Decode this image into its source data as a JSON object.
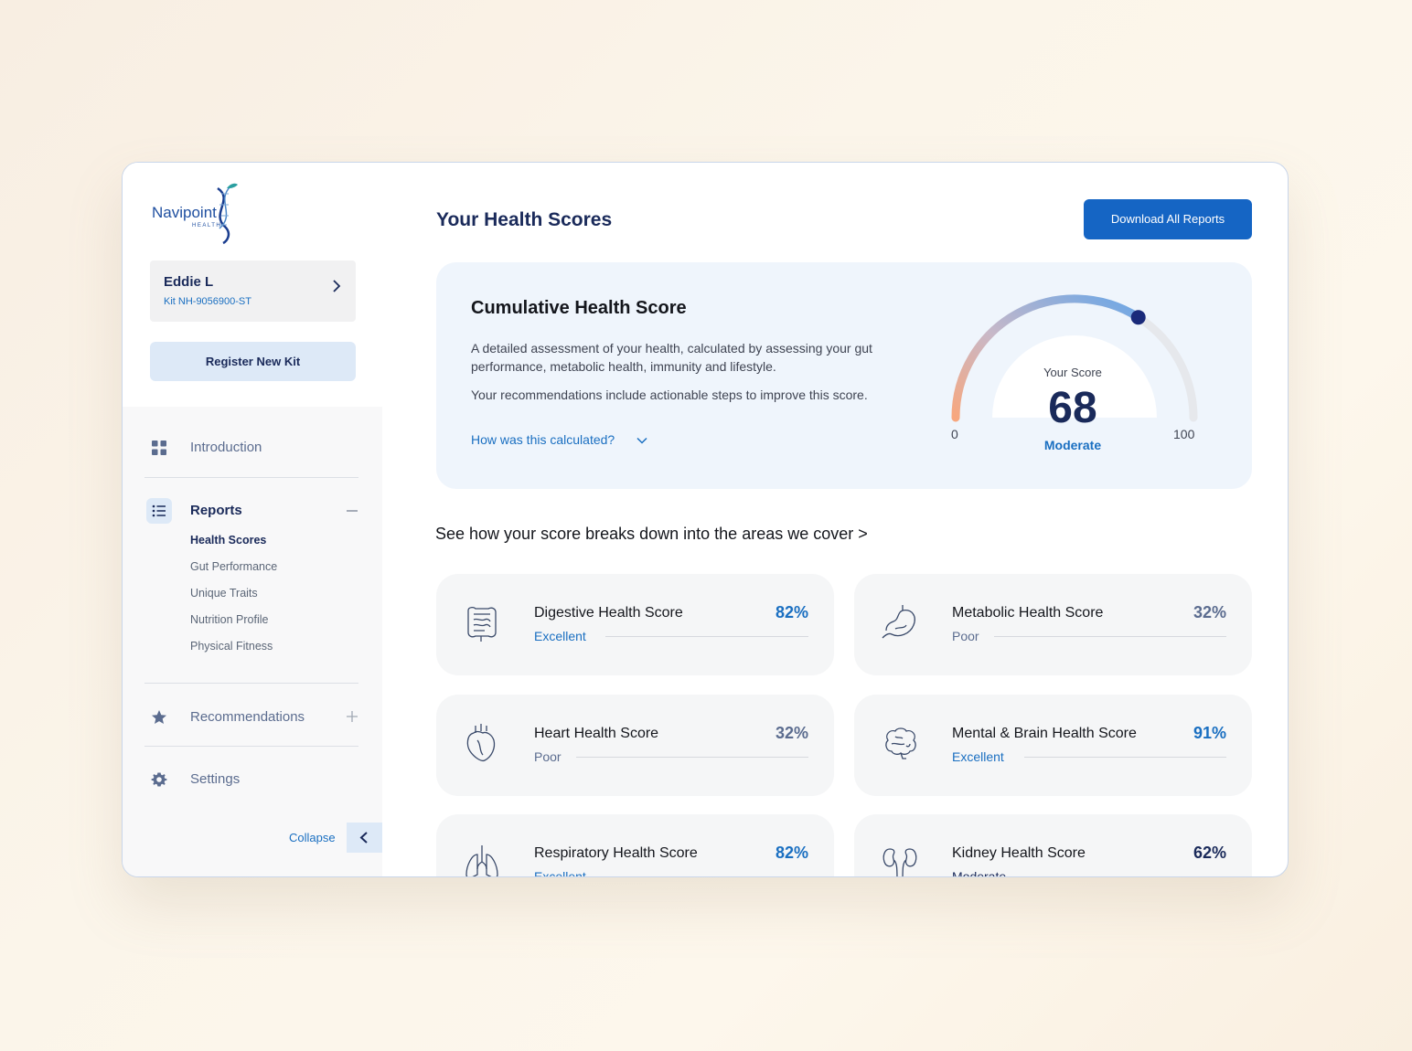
{
  "brand": {
    "name": "Navipoint",
    "sub": "HEALTH"
  },
  "user": {
    "name": "Eddie L",
    "kit": "Kit NH-9056900-ST"
  },
  "sidebar": {
    "register_label": "Register New Kit",
    "nav": {
      "introduction": "Introduction",
      "reports": "Reports",
      "recommendations": "Recommendations",
      "settings": "Settings"
    },
    "report_subitems": [
      "Health Scores",
      "Gut Performance",
      "Unique Traits",
      "Nutrition Profile",
      "Physical Fitness"
    ],
    "collapse_label": "Collapse"
  },
  "header": {
    "title": "Your Health Scores",
    "download_label": "Download All Reports"
  },
  "cumulative": {
    "title": "Cumulative Health Score",
    "description": "A detailed assessment of your health, calculated by assessing your gut performance, metabolic health, immunity and lifestyle.",
    "description2": "Your recommendations include actionable steps to improve this score.",
    "calc_link": "How was this calculated?",
    "gauge": {
      "label": "Your Score",
      "value": "68",
      "score": 68,
      "min": "0",
      "max": "100",
      "status": "Moderate"
    }
  },
  "breakdown_text": "See how your score breaks down into the areas we cover  >",
  "scores": [
    {
      "name": "Digestive Health Score",
      "pct": "82%",
      "status": "Excellent",
      "icon": "intestine-icon",
      "color": "#1a6fc1"
    },
    {
      "name": "Metabolic Health Score",
      "pct": "32%",
      "status": "Poor",
      "icon": "stomach-icon",
      "color": "#5b6c8f"
    },
    {
      "name": "Heart Health Score",
      "pct": "32%",
      "status": "Poor",
      "icon": "heart-organ-icon",
      "color": "#5b6c8f"
    },
    {
      "name": "Mental & Brain Health Score",
      "pct": "91%",
      "status": "Excellent",
      "icon": "brain-icon",
      "color": "#1a6fc1"
    },
    {
      "name": "Respiratory Health Score",
      "pct": "82%",
      "status": "Excellent",
      "icon": "lungs-icon",
      "color": "#1a6fc1"
    },
    {
      "name": "Kidney Health Score",
      "pct": "62%",
      "status": "Moderate",
      "icon": "kidney-icon",
      "color": "#1a2a5a"
    }
  ],
  "colors": {
    "accent": "#1565c4",
    "navy": "#1a2a5a",
    "link": "#1a6fc1",
    "muted": "#5b6c8f"
  }
}
